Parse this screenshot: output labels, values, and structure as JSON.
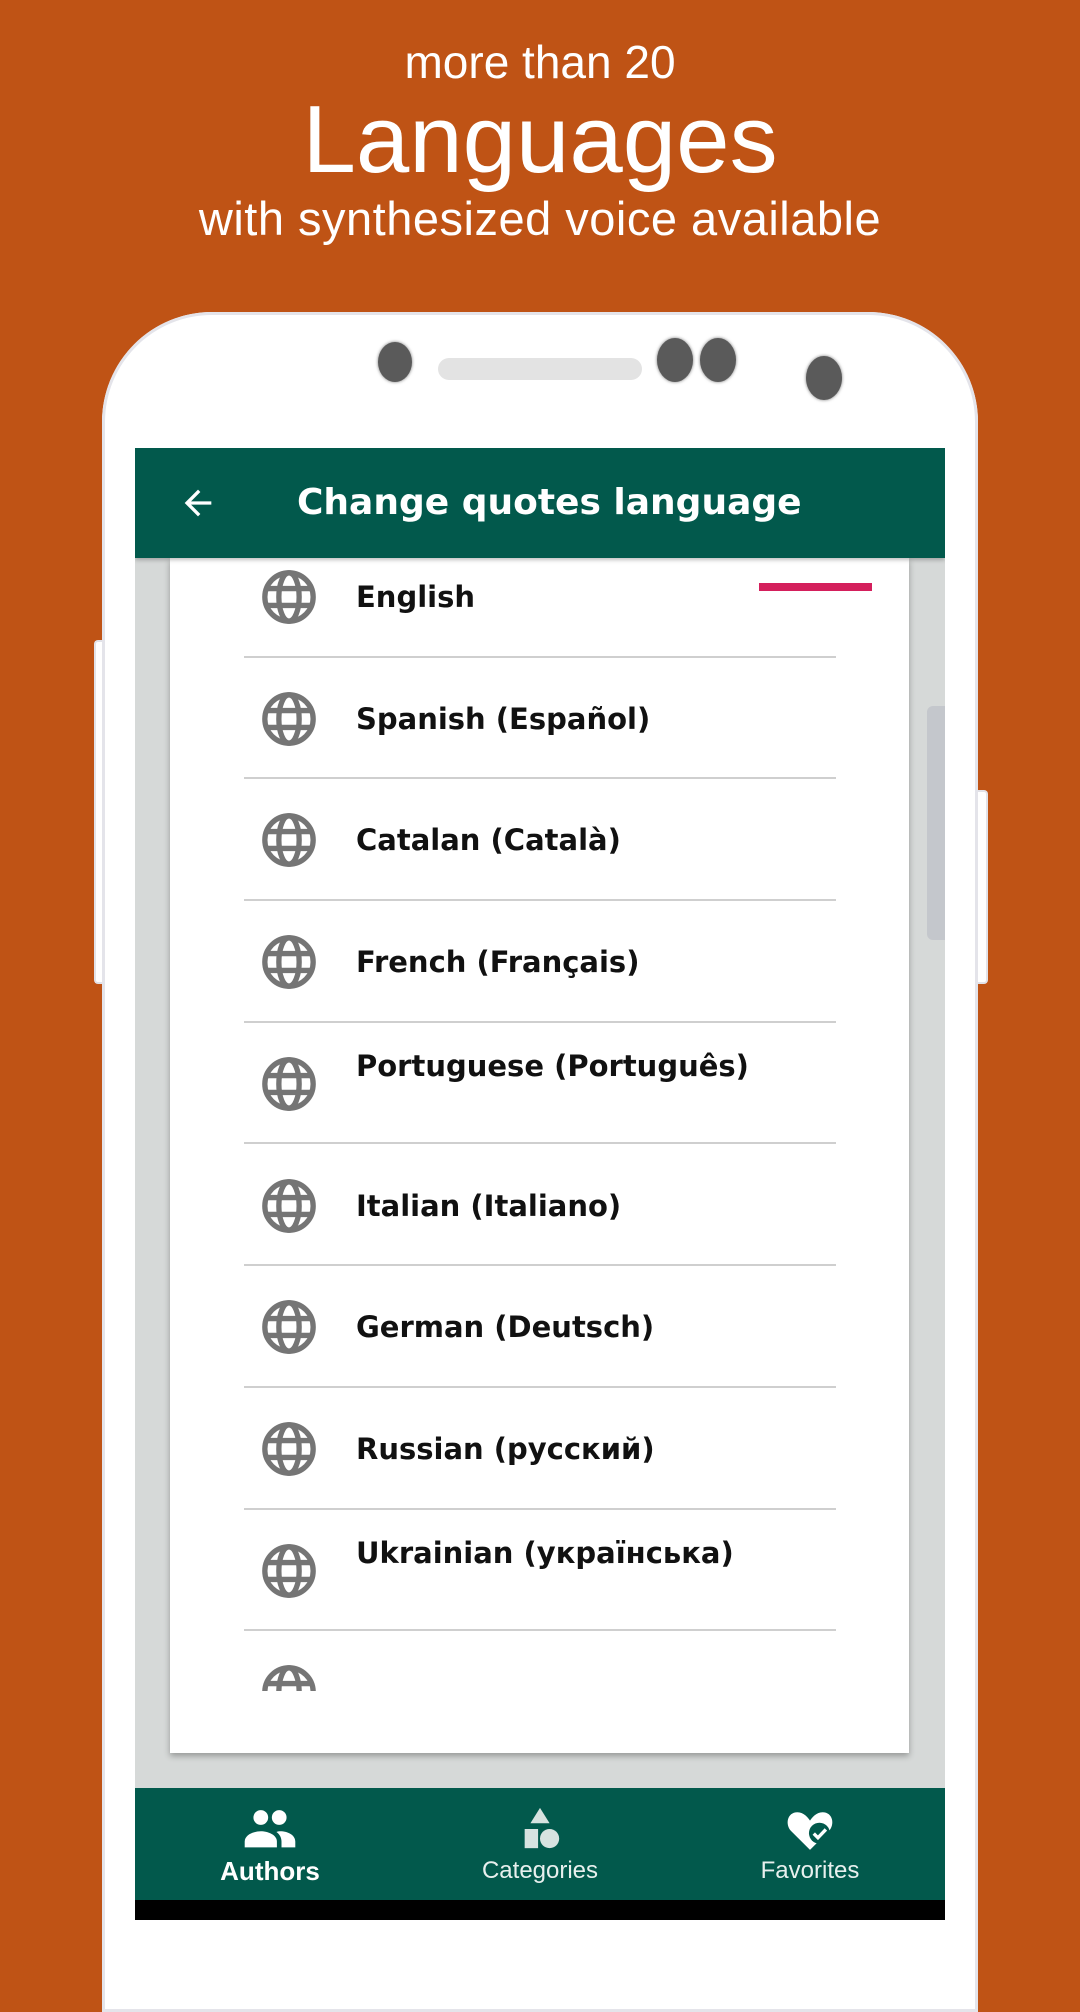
{
  "promo": {
    "line1": "more than 20",
    "line2": "Languages",
    "line3": "with synthesized voice available"
  },
  "toolbar": {
    "back_icon": "arrow-left-icon",
    "title": "Change quotes language"
  },
  "languages": [
    {
      "label": "English",
      "icon": "globe-icon",
      "selected": true
    },
    {
      "label": "Spanish (Español)",
      "icon": "globe-icon",
      "selected": false
    },
    {
      "label": "Catalan (Català)",
      "icon": "globe-icon",
      "selected": false
    },
    {
      "label": "French (Français)",
      "icon": "globe-icon",
      "selected": false
    },
    {
      "label": "Portuguese (Português)",
      "icon": "globe-icon",
      "selected": false
    },
    {
      "label": "Italian (Italiano)",
      "icon": "globe-icon",
      "selected": false
    },
    {
      "label": "German (Deutsch)",
      "icon": "globe-icon",
      "selected": false
    },
    {
      "label": "Russian (русский)",
      "icon": "globe-icon",
      "selected": false
    },
    {
      "label": "Ukrainian (українська)",
      "icon": "globe-icon",
      "selected": false
    }
  ],
  "bottom_nav": [
    {
      "label": "Authors",
      "icon": "people-icon",
      "active": true
    },
    {
      "label": "Categories",
      "icon": "shapes-icon",
      "active": false
    },
    {
      "label": "Favorites",
      "icon": "heart-check-icon",
      "active": false
    }
  ],
  "colors": {
    "background": "#bf5315",
    "primary": "#02594c",
    "selected_indicator": "#d41f5c",
    "icon_gray": "#757575"
  }
}
